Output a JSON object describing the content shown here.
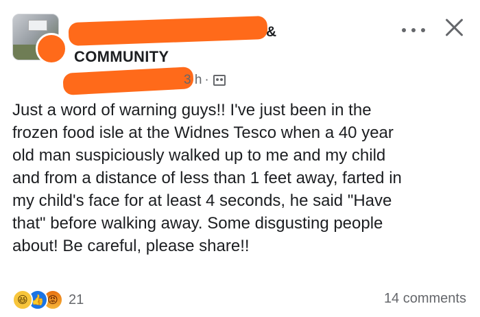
{
  "header": {
    "group_suffix": "&",
    "group_name": "COMMUNITY",
    "timestamp": "3 h",
    "separator": "·",
    "audience_icon": "group-audience-icon",
    "more_icon": "more-icon",
    "close_icon": "close-icon"
  },
  "post": {
    "text": "Just a word of warning guys!! I've just been in the\nfrozen food isle at the Widnes Tesco when a 40 year\nold man suspiciously walked up to me and my child\nand from a distance of less than 1 feet away, farted in\nmy child's face for at least 4 seconds, he said \"Have\nthat\" before walking away. Some disgusting people\nabout! Be careful, please share!!"
  },
  "footer": {
    "reactions": [
      {
        "type": "haha",
        "icon": "haha-reaction-icon"
      },
      {
        "type": "like",
        "icon": "like-reaction-icon"
      },
      {
        "type": "angry",
        "icon": "angry-reaction-icon"
      }
    ],
    "reaction_count": "21",
    "comments_label": "14 comments"
  },
  "colors": {
    "redaction": "#ff6a1a",
    "secondary_text": "#65676b",
    "primary_text": "#1c1e21"
  }
}
